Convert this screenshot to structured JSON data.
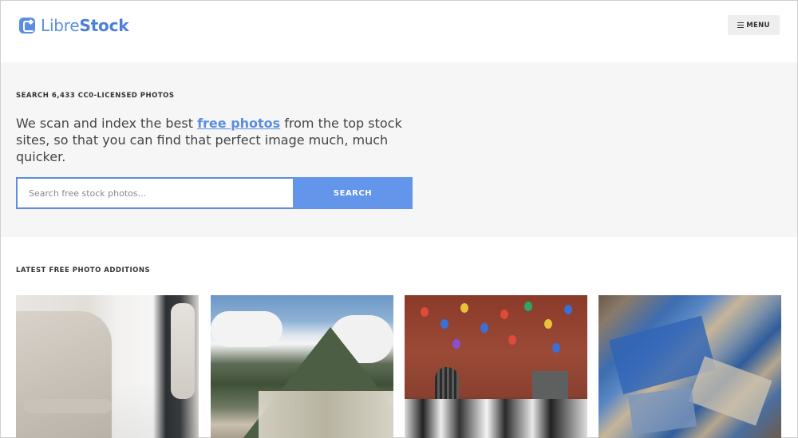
{
  "header": {
    "logo_light": "Libre",
    "logo_bold": "Stock",
    "menu_label": "MENU",
    "menu_icon": "hamburger-icon",
    "logo_icon": "librestock-logo-icon"
  },
  "hero": {
    "eyebrow": "SEARCH 6,433 CC0-LICENSED PHOTOS",
    "tagline_before": "We scan and index the best ",
    "tagline_link": "free photos",
    "tagline_after": " from the top stock sites, so that you can find that perfect image much, much quicker.",
    "search_placeholder": "Search free stock photos...",
    "search_button": "SEARCH"
  },
  "latest": {
    "heading": "LATEST FREE PHOTO ADDITIONS",
    "photos": [
      {
        "subject": "dental chair"
      },
      {
        "subject": "coastal mountain town"
      },
      {
        "subject": "wedding with balloons"
      },
      {
        "subject": "peeling blue paint texture"
      }
    ]
  },
  "colors": {
    "accent": "#5b8ee0",
    "button": "#6395ea",
    "hero_bg": "#f6f6f6",
    "menu_bg": "#eeeeee"
  }
}
